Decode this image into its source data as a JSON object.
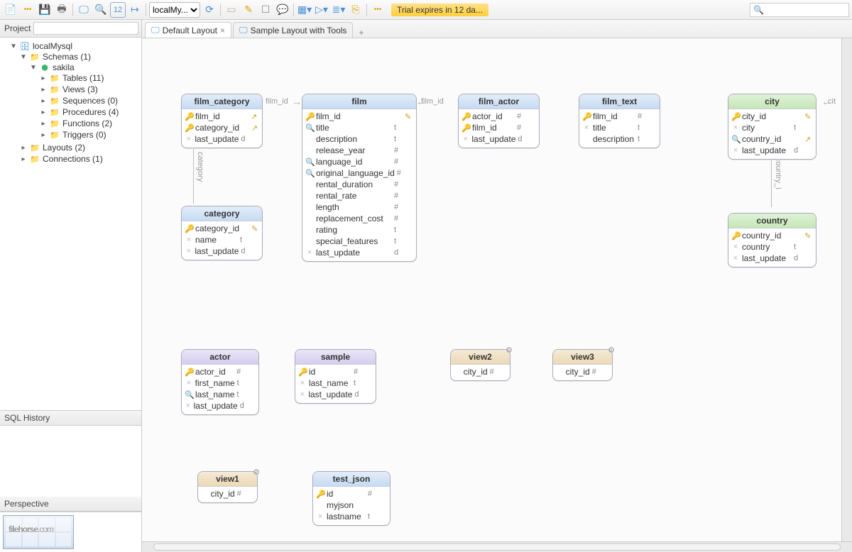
{
  "toolbar": {
    "connection": "localMy...",
    "trial": "Trial expires in 12 da...",
    "twelve": "12"
  },
  "project": {
    "title": "Project",
    "root": "localMysql",
    "schemas_label": "Schemas (1)",
    "schema": "sakila",
    "nodes": [
      {
        "label": "Tables (11)"
      },
      {
        "label": "Views (3)"
      },
      {
        "label": "Sequences (0)"
      },
      {
        "label": "Procedures (4)"
      },
      {
        "label": "Functions (2)"
      },
      {
        "label": "Triggers (0)"
      }
    ],
    "layouts": "Layouts (2)",
    "connections": "Connections (1)",
    "sql_history": "SQL History",
    "perspective": "Perspective"
  },
  "tabs": [
    {
      "label": "Default Layout",
      "active": true,
      "closable": true
    },
    {
      "label": "Sample Layout with Tools",
      "active": false,
      "closable": false
    }
  ],
  "entities": {
    "film_category": {
      "title": "film_category",
      "style": "blue",
      "cols": [
        {
          "k": "key",
          "n": "film_id",
          "t": "",
          "e": "↗"
        },
        {
          "k": "key",
          "n": "category_id",
          "t": "",
          "e": "↗"
        },
        {
          "k": "x",
          "n": "last_update",
          "t": "d",
          "e": ""
        }
      ]
    },
    "film": {
      "title": "film",
      "style": "blue",
      "cols": [
        {
          "k": "key",
          "n": "film_id",
          "t": "",
          "e": "✎"
        },
        {
          "k": "fk",
          "n": "title",
          "t": "t",
          "e": ""
        },
        {
          "k": "",
          "n": "description",
          "t": "t",
          "e": ""
        },
        {
          "k": "",
          "n": "release_year",
          "t": "#",
          "e": ""
        },
        {
          "k": "fk",
          "n": "language_id",
          "t": "#",
          "e": ""
        },
        {
          "k": "fk",
          "n": "original_language_id",
          "t": "#",
          "e": ""
        },
        {
          "k": "",
          "n": "rental_duration",
          "t": "#",
          "e": ""
        },
        {
          "k": "",
          "n": "rental_rate",
          "t": "#",
          "e": ""
        },
        {
          "k": "",
          "n": "length",
          "t": "#",
          "e": ""
        },
        {
          "k": "",
          "n": "replacement_cost",
          "t": "#",
          "e": ""
        },
        {
          "k": "",
          "n": "rating",
          "t": "t",
          "e": ""
        },
        {
          "k": "",
          "n": "special_features",
          "t": "t",
          "e": ""
        },
        {
          "k": "x",
          "n": "last_update",
          "t": "d",
          "e": ""
        }
      ]
    },
    "film_actor": {
      "title": "film_actor",
      "style": "blue",
      "cols": [
        {
          "k": "key",
          "n": "actor_id",
          "t": "#",
          "e": ""
        },
        {
          "k": "key",
          "n": "film_id",
          "t": "#",
          "e": ""
        },
        {
          "k": "x",
          "n": "last_update",
          "t": "d",
          "e": ""
        }
      ]
    },
    "film_text": {
      "title": "film_text",
      "style": "blue",
      "cols": [
        {
          "k": "key",
          "n": "film_id",
          "t": "#",
          "e": ""
        },
        {
          "k": "x",
          "n": "title",
          "t": "t",
          "e": ""
        },
        {
          "k": "",
          "n": "description",
          "t": "t",
          "e": ""
        }
      ]
    },
    "city": {
      "title": "city",
      "style": "green",
      "cols": [
        {
          "k": "key",
          "n": "city_id",
          "t": "",
          "e": "✎"
        },
        {
          "k": "x",
          "n": "city",
          "t": "t",
          "e": ""
        },
        {
          "k": "fk",
          "n": "country_id",
          "t": "",
          "e": "↗"
        },
        {
          "k": "x",
          "n": "last_update",
          "t": "d",
          "e": ""
        }
      ]
    },
    "category": {
      "title": "category",
      "style": "blue",
      "cols": [
        {
          "k": "key",
          "n": "category_id",
          "t": "",
          "e": "✎"
        },
        {
          "k": "x",
          "n": "name",
          "t": "t",
          "e": ""
        },
        {
          "k": "x",
          "n": "last_update",
          "t": "d",
          "e": ""
        }
      ]
    },
    "country": {
      "title": "country",
      "style": "green",
      "cols": [
        {
          "k": "key",
          "n": "country_id",
          "t": "",
          "e": "✎"
        },
        {
          "k": "x",
          "n": "country",
          "t": "t",
          "e": ""
        },
        {
          "k": "x",
          "n": "last_update",
          "t": "d",
          "e": ""
        }
      ]
    },
    "actor": {
      "title": "actor",
      "style": "purple",
      "cols": [
        {
          "k": "key",
          "n": "actor_id",
          "t": "#",
          "e": ""
        },
        {
          "k": "x",
          "n": "first_name",
          "t": "t",
          "e": ""
        },
        {
          "k": "fk",
          "n": "last_name",
          "t": "t",
          "e": ""
        },
        {
          "k": "x",
          "n": "last_update",
          "t": "d",
          "e": ""
        }
      ]
    },
    "sample": {
      "title": "sample",
      "style": "purple",
      "cols": [
        {
          "k": "key",
          "n": "id",
          "t": "#",
          "e": ""
        },
        {
          "k": "x",
          "n": "last_name",
          "t": "t",
          "e": ""
        },
        {
          "k": "x",
          "n": "last_update",
          "t": "d",
          "e": ""
        }
      ]
    },
    "view2": {
      "title": "view2",
      "style": "tan",
      "cols": [
        {
          "k": "",
          "n": "city_id",
          "t": "#",
          "e": ""
        }
      ]
    },
    "view3": {
      "title": "view3",
      "style": "tan",
      "cols": [
        {
          "k": "",
          "n": "city_id",
          "t": "#",
          "e": ""
        }
      ]
    },
    "view1": {
      "title": "view1",
      "style": "tan",
      "cols": [
        {
          "k": "",
          "n": "city_id",
          "t": "#",
          "e": ""
        }
      ]
    },
    "test_json": {
      "title": "test_json",
      "style": "blue",
      "cols": [
        {
          "k": "key",
          "n": "id",
          "t": "#",
          "e": ""
        },
        {
          "k": "",
          "n": "myjson",
          "t": "",
          "e": ""
        },
        {
          "k": "x",
          "n": "lastname",
          "t": "t",
          "e": ""
        }
      ]
    }
  },
  "rel": {
    "film_id": "film_id",
    "category": "category",
    "country": "country_i",
    "cit": "cit"
  },
  "watermark": {
    "a": "filehorse",
    "b": ".com"
  }
}
